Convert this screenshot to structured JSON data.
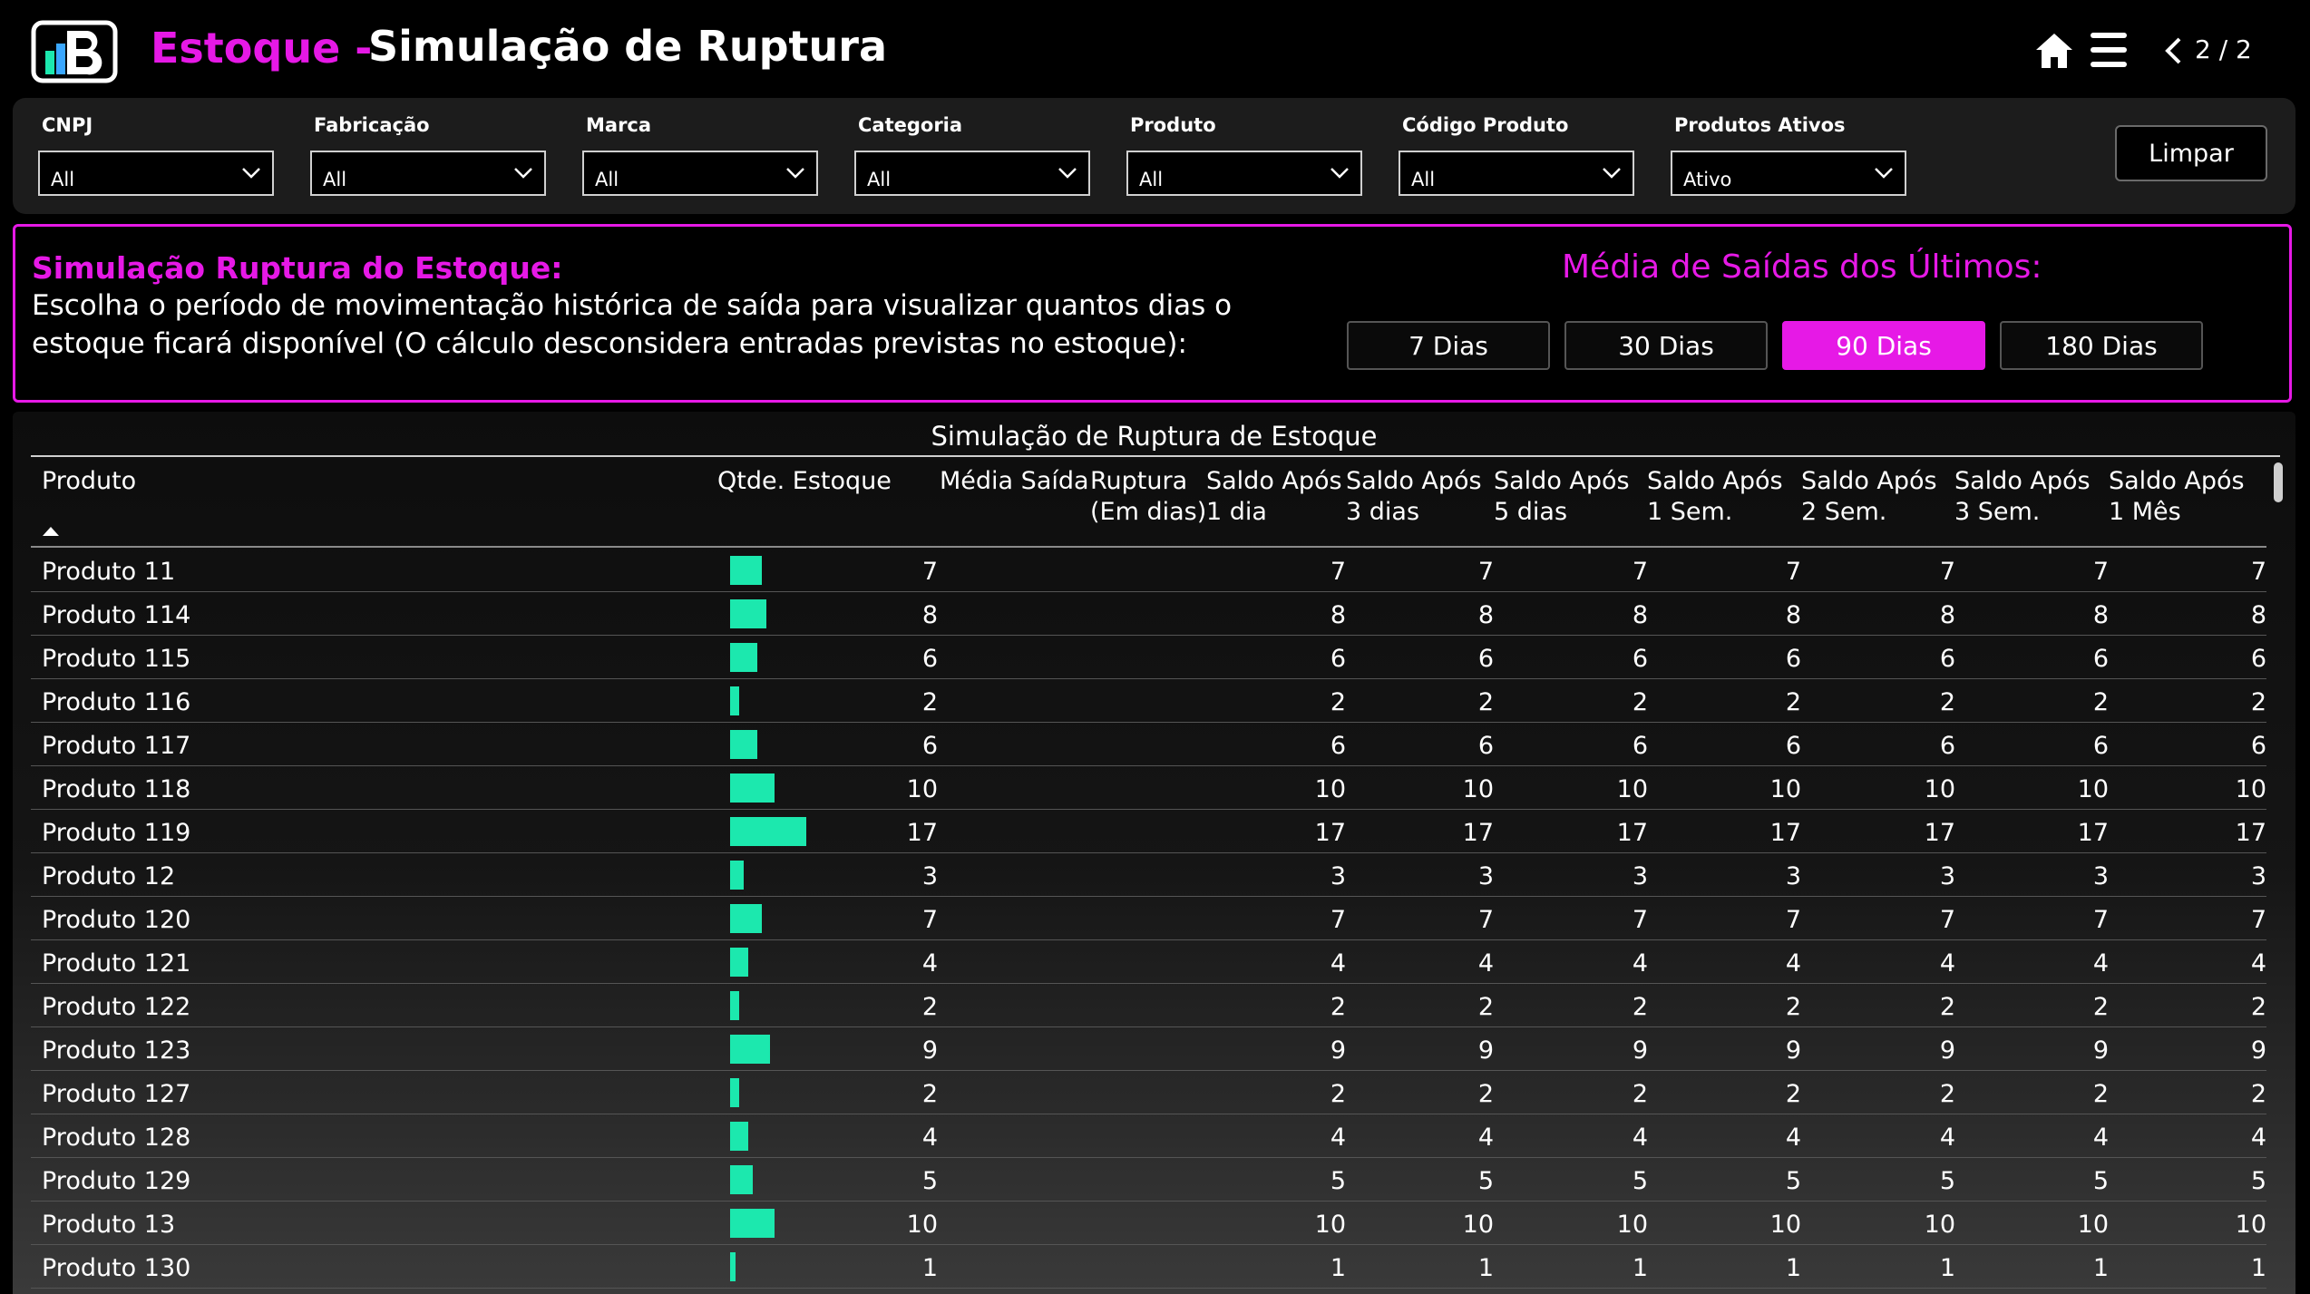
{
  "header": {
    "title_accent": "Estoque -",
    "title_main": "Simulação de Ruptura",
    "page_indicator": "2 / 2"
  },
  "filters": [
    {
      "label": "CNPJ",
      "value": "All"
    },
    {
      "label": "Fabricação",
      "value": "All"
    },
    {
      "label": "Marca",
      "value": "All"
    },
    {
      "label": "Categoria",
      "value": "All"
    },
    {
      "label": "Produto",
      "value": "All"
    },
    {
      "label": "Código Produto",
      "value": "All"
    },
    {
      "label": "Produtos Ativos",
      "value": "Ativo"
    }
  ],
  "clear_label": "Limpar",
  "simulation": {
    "title": "Simulação Ruptura do Estoque:",
    "description": "Escolha o período de movimentação histórica de saída para visualizar quantos dias o estoque ficará disponível (O cálculo desconsidera entradas previstas no estoque):",
    "media_title": "Média de Saídas dos Últimos:",
    "periods": [
      {
        "label": "7 Dias",
        "active": false
      },
      {
        "label": "30 Dias",
        "active": false
      },
      {
        "label": "90 Dias",
        "active": true
      },
      {
        "label": "180 Dias",
        "active": false
      }
    ]
  },
  "table": {
    "title": "Simulação de Ruptura de Estoque",
    "columns": {
      "produto": "Produto",
      "qtde": "Qtde. Estoque",
      "media": "Média Saída",
      "ruptura_1": "Ruptura",
      "ruptura_2": "(Em dias)",
      "s1_1": "Saldo Após",
      "s1_2": "1 dia",
      "s2_1": "Saldo Após",
      "s2_2": "3 dias",
      "s3_1": "Saldo Após",
      "s3_2": "5 dias",
      "s4_1": "Saldo Após",
      "s4_2": "1 Sem.",
      "s5_1": "Saldo Após",
      "s5_2": "2 Sem.",
      "s6_1": "Saldo Após",
      "s6_2": "3 Sem.",
      "s7_1": "Saldo Após",
      "s7_2": "1 Mês"
    },
    "bar_max": 17,
    "rows": [
      {
        "produto": "Produto 11",
        "qtde": 7
      },
      {
        "produto": "Produto 114",
        "qtde": 8
      },
      {
        "produto": "Produto 115",
        "qtde": 6
      },
      {
        "produto": "Produto 116",
        "qtde": 2
      },
      {
        "produto": "Produto 117",
        "qtde": 6
      },
      {
        "produto": "Produto 118",
        "qtde": 10
      },
      {
        "produto": "Produto 119",
        "qtde": 17
      },
      {
        "produto": "Produto 12",
        "qtde": 3
      },
      {
        "produto": "Produto 120",
        "qtde": 7
      },
      {
        "produto": "Produto 121",
        "qtde": 4
      },
      {
        "produto": "Produto 122",
        "qtde": 2
      },
      {
        "produto": "Produto 123",
        "qtde": 9
      },
      {
        "produto": "Produto 127",
        "qtde": 2
      },
      {
        "produto": "Produto 128",
        "qtde": 4
      },
      {
        "produto": "Produto 129",
        "qtde": 5
      },
      {
        "produto": "Produto 13",
        "qtde": 10
      },
      {
        "produto": "Produto 130",
        "qtde": 1
      }
    ]
  },
  "colors": {
    "accent": "#e619e6",
    "bar": "#1ce8ae",
    "background": "#000000"
  },
  "icons": [
    "logo-b-icon",
    "home-icon",
    "menu-icon",
    "chevron-left-icon",
    "chevron-down-icon",
    "sort-up-icon"
  ]
}
